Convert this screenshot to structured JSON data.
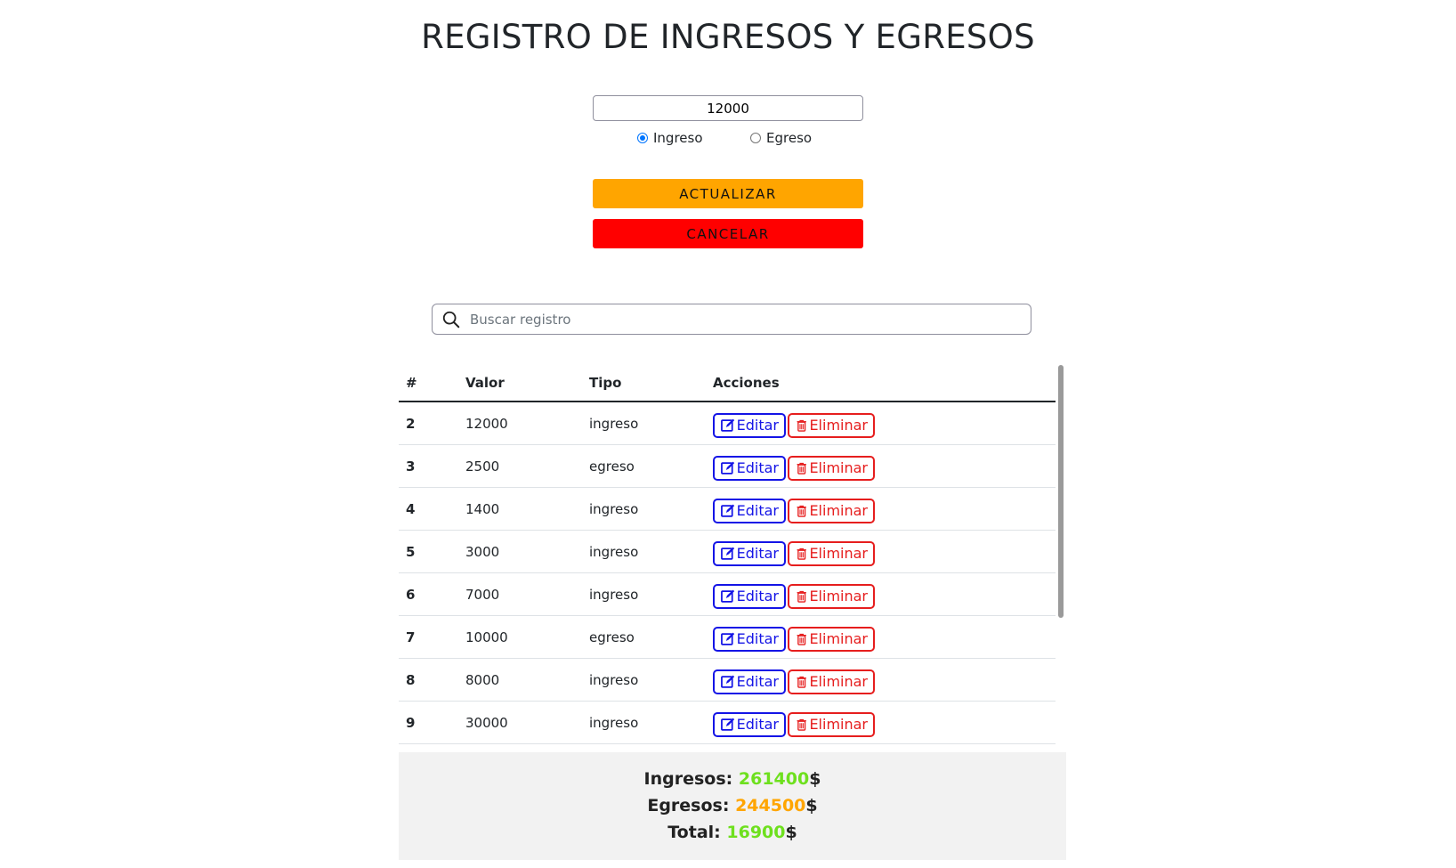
{
  "title": "REGISTRO DE INGRESOS Y EGRESOS",
  "form": {
    "amount_value": "12000",
    "radio_options": [
      {
        "label": "Ingreso",
        "checked": true
      },
      {
        "label": "Egreso",
        "checked": false
      }
    ],
    "update_label": "ACTUALIZAR",
    "cancel_label": "CANCELAR"
  },
  "search": {
    "placeholder": "Buscar registro"
  },
  "table": {
    "headers": [
      "#",
      "Valor",
      "Tipo",
      "Acciones"
    ],
    "edit_label": "Editar",
    "delete_label": "Eliminar",
    "rows": [
      {
        "id": "2",
        "valor": "12000",
        "tipo": "ingreso"
      },
      {
        "id": "3",
        "valor": "2500",
        "tipo": "egreso"
      },
      {
        "id": "4",
        "valor": "1400",
        "tipo": "ingreso"
      },
      {
        "id": "5",
        "valor": "3000",
        "tipo": "ingreso"
      },
      {
        "id": "6",
        "valor": "7000",
        "tipo": "ingreso"
      },
      {
        "id": "7",
        "valor": "10000",
        "tipo": "egreso"
      },
      {
        "id": "8",
        "valor": "8000",
        "tipo": "ingreso"
      },
      {
        "id": "9",
        "valor": "30000",
        "tipo": "ingreso"
      }
    ]
  },
  "totals": {
    "ingresos_label": "Ingresos:",
    "ingresos_value": "261400",
    "egresos_label": "Egresos:",
    "egresos_value": "244500",
    "total_label": "Total:",
    "total_value": "16900",
    "currency": "$"
  },
  "colors": {
    "update_button": "#ffa500",
    "cancel_button": "#ff0000",
    "edit_accent": "#1414e6",
    "delete_accent": "#e61e1e",
    "positive": "#6ee01e",
    "egresos": "#ffa500"
  }
}
